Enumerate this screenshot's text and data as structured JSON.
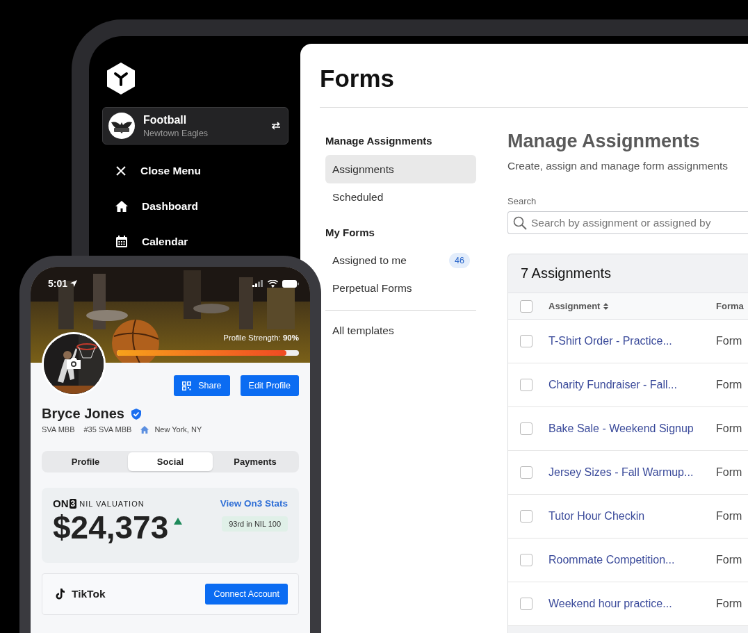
{
  "tablet": {
    "sidebar": {
      "team": {
        "name": "Football",
        "subtitle": "Newtown Eagles"
      },
      "menu": [
        {
          "label": "Close Menu",
          "kind": "close"
        },
        {
          "label": "Dashboard",
          "kind": "home"
        },
        {
          "label": "Calendar",
          "kind": "calendar"
        }
      ]
    },
    "page_title": "Forms",
    "nav": {
      "sections": [
        {
          "heading": "Manage Assignments",
          "items": [
            {
              "label": "Assignments",
              "selected": true
            },
            {
              "label": "Scheduled",
              "selected": false
            }
          ]
        },
        {
          "heading": "My Forms",
          "items": [
            {
              "label": "Assigned to me",
              "selected": false,
              "badge": "46"
            },
            {
              "label": "Perpetual Forms",
              "selected": false
            }
          ]
        }
      ],
      "footer_items": [
        {
          "label": "All templates",
          "selected": false
        }
      ]
    },
    "main": {
      "title": "Manage Assignments",
      "subtitle": "Create, assign and manage form assignments",
      "search": {
        "label": "Search",
        "placeholder": "Search by assignment or assigned by"
      },
      "table": {
        "title": "7 Assignments",
        "header_checked": false,
        "columns": [
          {
            "label": "Assignment",
            "sortable": true
          },
          {
            "label": "Forma"
          }
        ],
        "rows": [
          {
            "assignment": "T-Shirt Order - Practice...",
            "column_2": "Form",
            "checked": false
          },
          {
            "assignment": "Charity Fundraiser - Fall...",
            "column_2": "Form",
            "checked": false
          },
          {
            "assignment": "Bake Sale - Weekend Signup",
            "column_2": "Form",
            "checked": false
          },
          {
            "assignment": "Jersey Sizes - Fall Warmup...",
            "column_2": "Form",
            "checked": false
          },
          {
            "assignment": "Tutor Hour Checkin",
            "column_2": "Form",
            "checked": false
          },
          {
            "assignment": "Roommate Competition...",
            "column_2": "Form",
            "checked": false
          },
          {
            "assignment": "Weekend hour practice...",
            "column_2": "Form",
            "checked": false
          }
        ]
      }
    }
  },
  "phone": {
    "status_bar": {
      "time": "5:01"
    },
    "profile_strength": {
      "text": "Profile Strength: **90%**",
      "level": 0.93
    },
    "actions": [
      {
        "label": "Share",
        "kind": "qr"
      },
      {
        "label": "Edit Profile",
        "kind": "plain"
      }
    ],
    "name": "Bryce Jones",
    "verified": true,
    "meta": [
      {
        "text": "SVA MBB",
        "kind": "text"
      },
      {
        "text": "#35 SVA MBB",
        "kind": "text"
      },
      {
        "text": "New York, NY",
        "kind": "home"
      }
    ],
    "tabs": [
      {
        "label": "Profile",
        "selected": false
      },
      {
        "label": "Social",
        "selected": true
      },
      {
        "label": "Payments",
        "selected": false
      }
    ],
    "valuation": {
      "brand": "ON",
      "brand_mark": "3",
      "label": "NIL VALUATION",
      "link": "View On3 Stats",
      "amount": "$24,373",
      "rising": true,
      "rank": "93rd in NIL 100"
    },
    "socials": [
      {
        "name": "TikTok",
        "action": "Connect Account"
      }
    ]
  }
}
